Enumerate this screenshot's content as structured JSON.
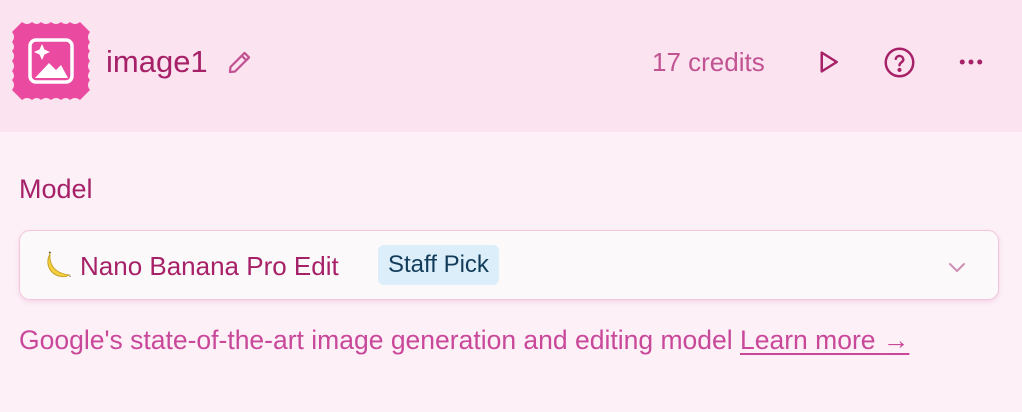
{
  "header": {
    "title": "image1",
    "credits": "17 credits",
    "node_icon": "image-sparkle-icon",
    "edit_icon": "pencil-icon",
    "run_icon": "play-icon",
    "help_icon": "help-circle-icon",
    "menu_icon": "more-horizontal-icon"
  },
  "model": {
    "label": "Model",
    "selected": {
      "emoji_icon": "banana-icon",
      "name": "Nano Banana Pro Edit",
      "badge": "Staff Pick"
    },
    "dropdown_icon": "chevron-down-icon",
    "description": "Google's state-of-the-art image generation and editing model",
    "learn_more": "Learn more",
    "learn_more_arrow": "→"
  },
  "colors": {
    "background": "#fdf0f7",
    "header_background": "#fbe3f0",
    "accent": "#e8449f",
    "text": "#a62168",
    "muted_text": "#c9489a",
    "badge_background": "#dbeefa",
    "badge_text": "#123c5a"
  }
}
